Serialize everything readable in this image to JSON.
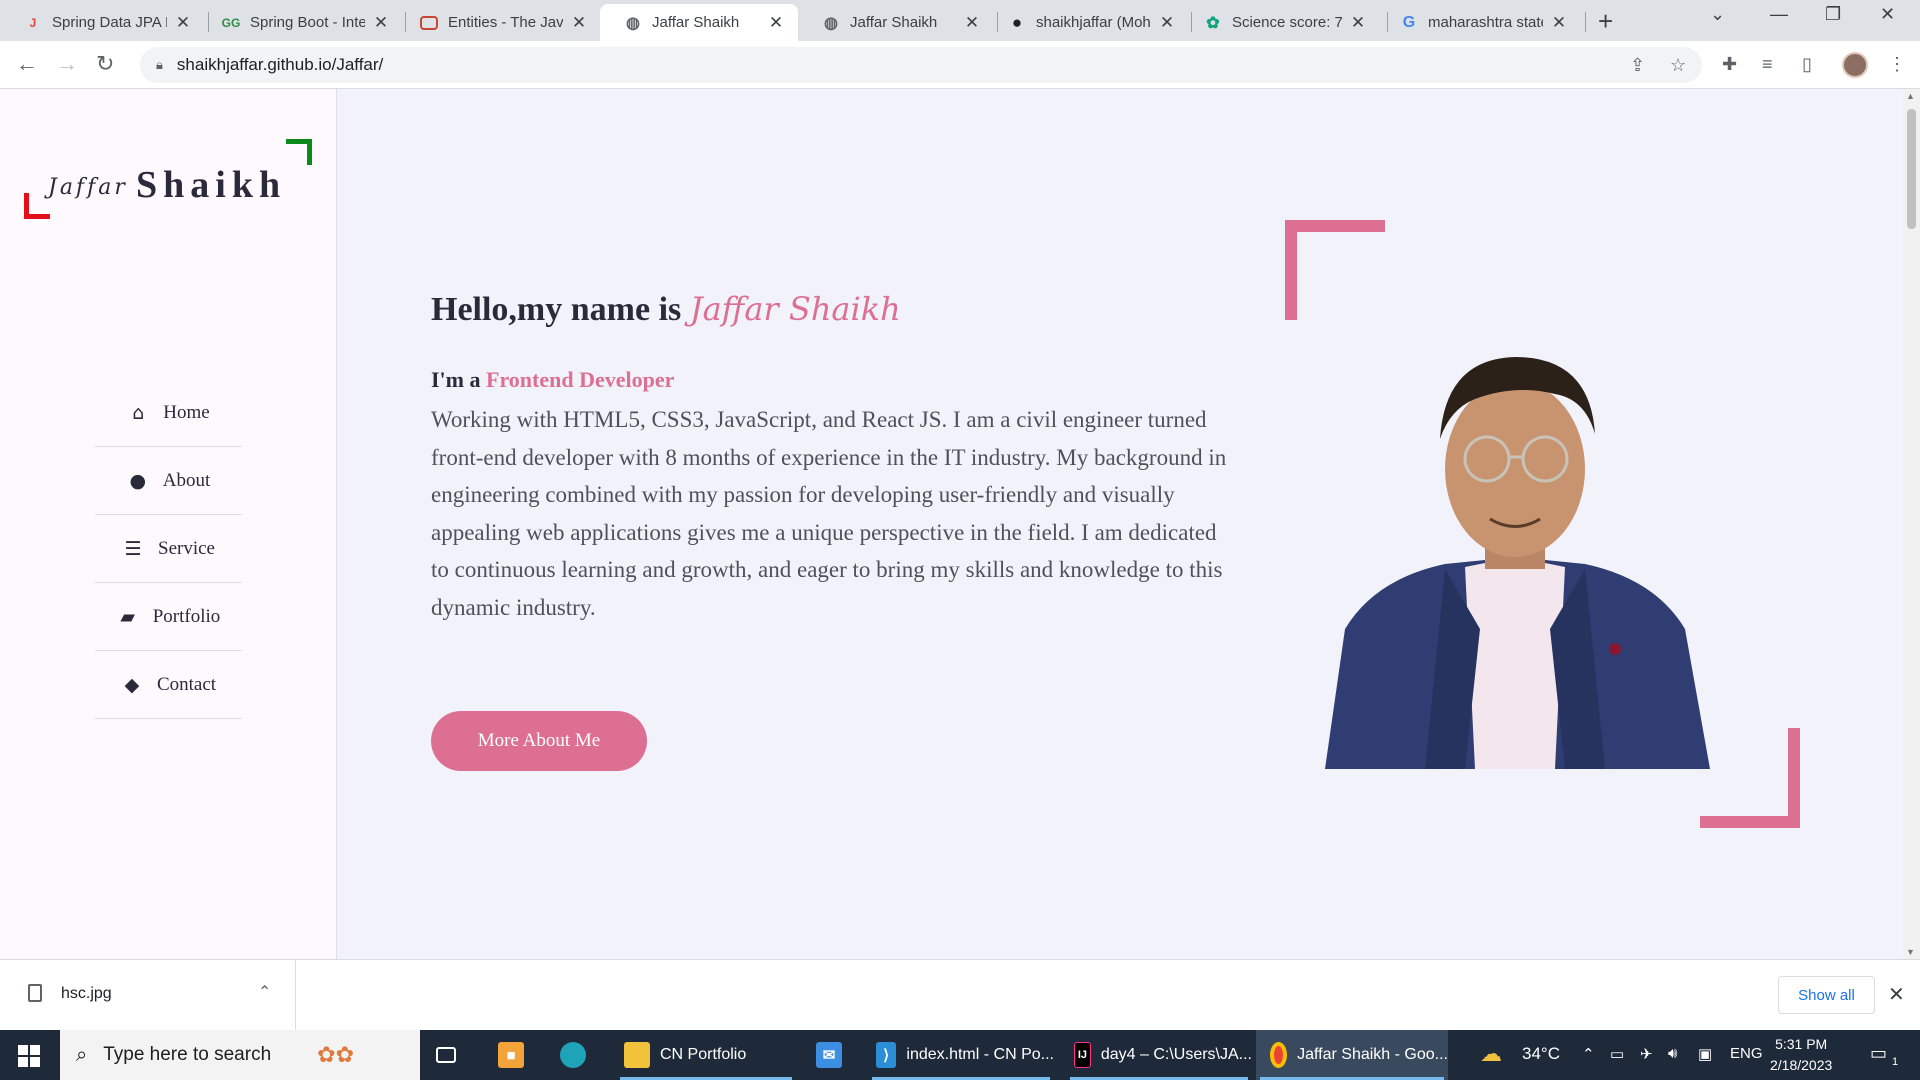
{
  "browser": {
    "tabs": [
      {
        "title": "Spring Data JPA E",
        "icon": "jpa-favicon",
        "color": "#e8453c"
      },
      {
        "title": "Spring Boot - Inte",
        "icon": "gfg-favicon",
        "color": "#2f8d46"
      },
      {
        "title": "Entities - The Jav",
        "icon": "oracle-favicon",
        "color": "#c74634"
      },
      {
        "title": "Jaffar Shaikh",
        "icon": "globe-icon",
        "color": "#5f6368",
        "active": true
      },
      {
        "title": "Jaffar Shaikh",
        "icon": "globe-icon",
        "color": "#5f6368"
      },
      {
        "title": "shaikhjaffar (Moh",
        "icon": "github-icon",
        "color": "#202124"
      },
      {
        "title": "Science score: 72",
        "icon": "chatgpt-icon",
        "color": "#10a37f"
      },
      {
        "title": "maharashtra state",
        "icon": "google-icon",
        "color": "#4285f4"
      }
    ],
    "url": "shaikhjaffar.github.io/Jaffar/"
  },
  "logo": {
    "first": "Jaffar",
    "last": "Shaikh"
  },
  "nav": [
    {
      "label": "Home",
      "icon": "home-icon",
      "glyph": "⌂"
    },
    {
      "label": "About",
      "icon": "user-icon",
      "glyph": "●"
    },
    {
      "label": "Service",
      "icon": "list-icon",
      "glyph": "☰"
    },
    {
      "label": "Portfolio",
      "icon": "briefcase-icon",
      "glyph": "▰"
    },
    {
      "label": "Contact",
      "icon": "comments-icon",
      "glyph": "◆"
    }
  ],
  "hero": {
    "greeting": "Hello,my name is",
    "name": "Jaffar Shaikh",
    "role_prefix": "I'm a",
    "role": "Frontend Developer",
    "bio": "Working with HTML5, CSS3, JavaScript, and React JS. I am a civil engineer turned front-end developer with 8 months of experience in the IT industry. My background in engineering combined with my passion for developing user-friendly and visually appealing web applications gives me a unique perspective in the field. I am dedicated to continuous learning and growth, and eager to bring my skills and knowledge to this dynamic industry.",
    "cta": "More About Me"
  },
  "colors": {
    "accent": "#dc6f92",
    "logo_green": "#0b8a1a",
    "logo_red": "#e3101a"
  },
  "downloads": {
    "file": "hsc.jpg",
    "show_all": "Show all"
  },
  "taskbar": {
    "search_placeholder": "Type here to search",
    "apps": [
      {
        "label": "CN Portfolio",
        "icon": "folder-icon"
      },
      {
        "label": "index.html - CN Po...",
        "icon": "vscode-icon"
      },
      {
        "label": "day4 – C:\\Users\\JA...",
        "icon": "intellij-icon"
      },
      {
        "label": "Jaffar Shaikh - Goo...",
        "icon": "chrome-icon"
      }
    ],
    "weather": "34°C",
    "language": "ENG",
    "time": "5:31 PM",
    "date": "2/18/2023",
    "notifications": "1"
  }
}
